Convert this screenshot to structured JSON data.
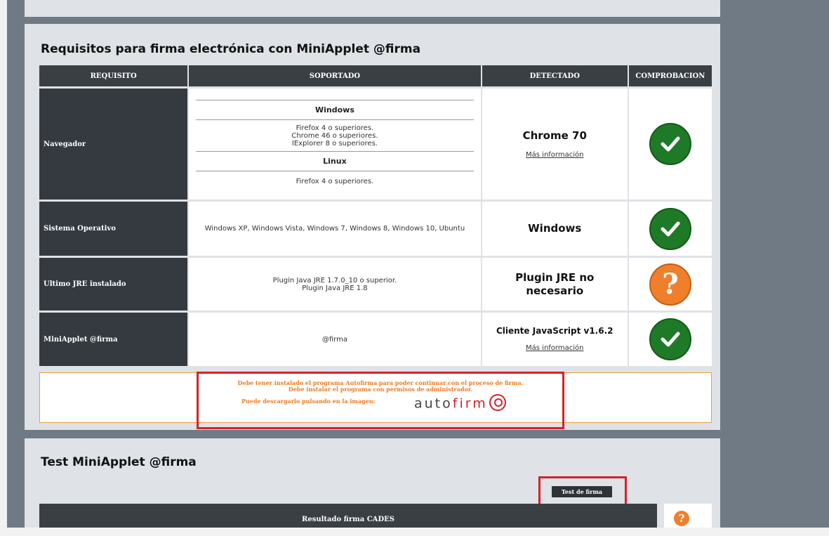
{
  "sections": {
    "requirements_title": "Requisitos para firma electrónica con MiniApplet @firma",
    "test_title": "Test MiniApplet @firma"
  },
  "table": {
    "headers": [
      "REQUISITO",
      "SOPORTADO",
      "DETECTADO",
      "COMPROBACION"
    ],
    "rows": [
      {
        "name": "Navegador",
        "supported": {
          "windows_label": "Windows",
          "windows_lines": [
            "Firefox 4 o superiores.",
            "Chrome 46 o superiores.",
            "IExplorer 8 o superiores."
          ],
          "linux_label": "Linux",
          "linux_lines": [
            "Firefox 4 o superiores."
          ]
        },
        "detected": "Chrome 70",
        "link": "Más información",
        "status": "ok"
      },
      {
        "name": "Sistema Operativo",
        "supported_text": "Windows XP, Windows Vista, Windows 7, Windows 8, Windows 10, Ubuntu",
        "detected": "Windows",
        "status": "ok"
      },
      {
        "name": "Ultimo JRE instalado",
        "supported_lines": [
          "Plugin Java JRE 1.7.0_10 o superior.",
          "Plugin Java JRE 1.8"
        ],
        "detected": "Plugin JRE no necesario",
        "status": "warning"
      },
      {
        "name": "MiniApplet @firma",
        "supported_text": "@firma",
        "detected": "Cliente JavaScript v1.6.2",
        "link": "Más información",
        "status": "ok"
      }
    ]
  },
  "notice": {
    "line1": "Debe tener instalado el programa Autofirma para poder continuar con el proceso de firma.",
    "line2": "Debe instalar el programa con permisos de administrador.",
    "download_label": "Puede descargarlo pulsando en la imagen:",
    "logo_prefix": "auto",
    "logo_suffix": "firm"
  },
  "test": {
    "button_label": "Test de firma",
    "result_header": "Resultado firma CADES"
  },
  "icons": {
    "check": "✓",
    "question": "?"
  },
  "colors": {
    "ok": "#1e7a27",
    "warning": "#f07f2c",
    "highlight": "#d9202a"
  }
}
